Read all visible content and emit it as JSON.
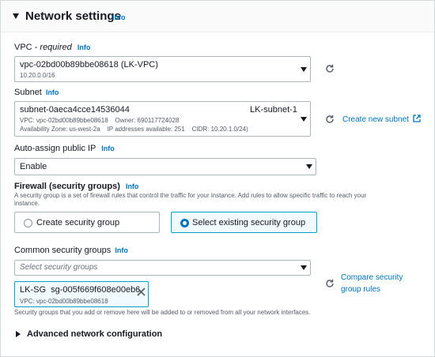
{
  "section": {
    "title": "Network settings",
    "info": "Info"
  },
  "vpc": {
    "label": "VPC",
    "required": " - required",
    "info": "Info",
    "value": "vpc-02bd00b89bbe08618 (LK-VPC)",
    "cidr": "10.20.0.0/16"
  },
  "subnet": {
    "label": "Subnet",
    "info": "Info",
    "id": "subnet-0aeca4cce14536044",
    "name": "LK-subnet-1",
    "vpc_line": "VPC: vpc-02bd00b89bbe08618    Owner: 690117724028",
    "az_line": "Availability Zone: us-west-2a    IP addresses available: 251    CIDR: 10.20.1.0/24)",
    "create_link": "Create new subnet"
  },
  "public_ip": {
    "label": "Auto-assign public IP",
    "info": "Info",
    "value": "Enable"
  },
  "firewall": {
    "label": "Firewall (security groups)",
    "info": "Info",
    "desc1": "A security group is a set of firewall rules that control the traffic for your instance. Add rules to allow specific traffic to reach your",
    "desc2": "instance.",
    "option_create": "Create security group",
    "option_select": "Select existing security group",
    "selected": "select"
  },
  "common_sg": {
    "label": "Common security groups",
    "info": "Info",
    "placeholder": "Select security groups",
    "compare_link1": "Compare security",
    "compare_link2": "group rules",
    "token_name": "LK-SG",
    "token_id": "sg-005f669f608e00eb6",
    "token_vpc": "VPC: vpc-02bd00b89bbe08618",
    "note": "Security groups that you add or remove here will be added to or removed from all your network interfaces."
  },
  "advanced": {
    "label": "Advanced network configuration"
  },
  "colors": {
    "link": "#0073bb",
    "selected_bg": "#f1faff",
    "selected_border": "#00a1c9"
  }
}
